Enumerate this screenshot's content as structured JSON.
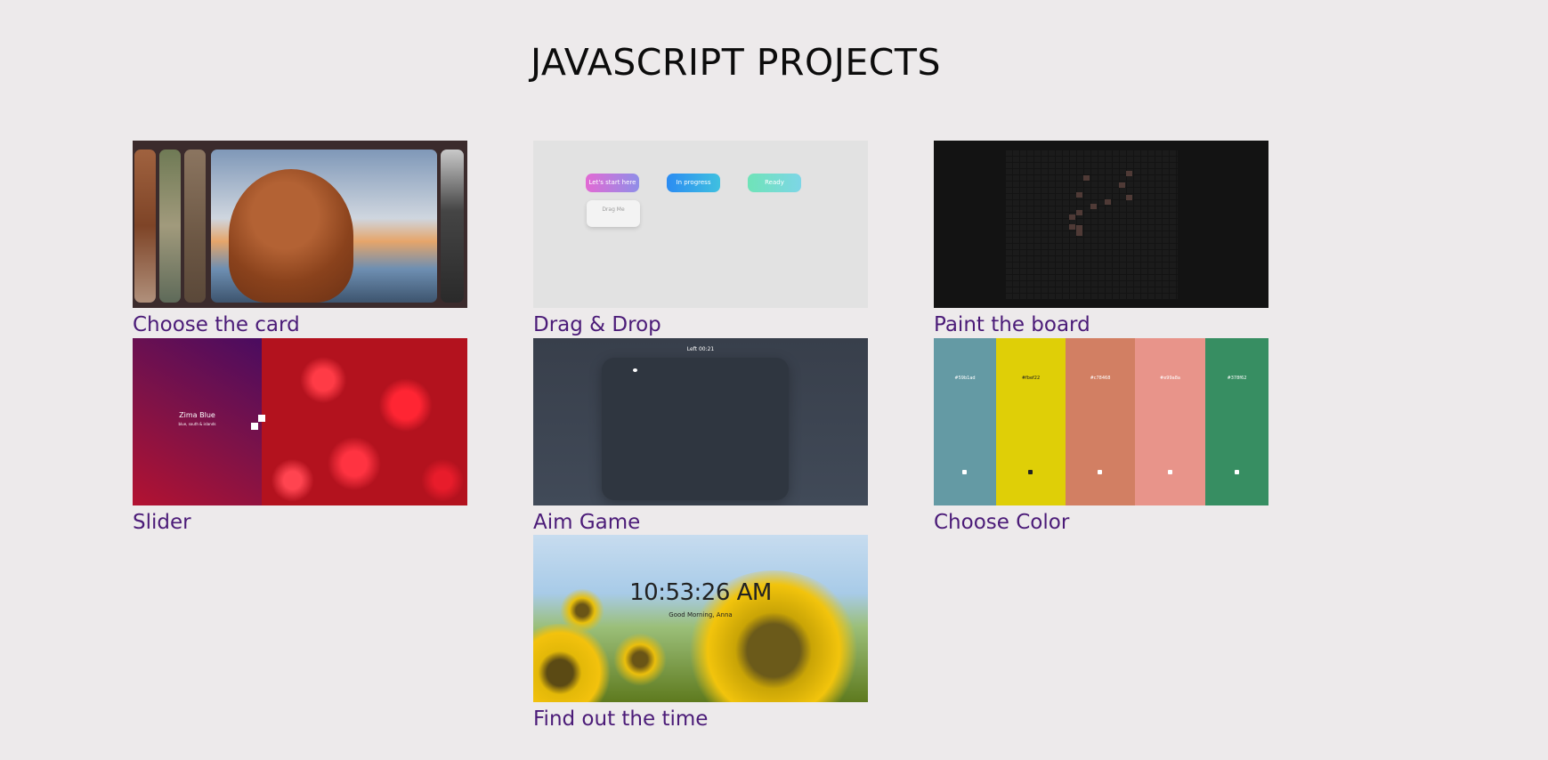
{
  "page_title": "JAVASCRIPT PROJECTS",
  "projects": [
    {
      "label": "Choose the card"
    },
    {
      "label": "Drag & Drop",
      "columns": [
        "Let's start here",
        "In progress",
        "Ready"
      ],
      "draggable": "Drag Me"
    },
    {
      "label": "Paint the board"
    },
    {
      "label": "Slider",
      "slide_title": "Zima Blue",
      "slide_sub": "blue, south & islands"
    },
    {
      "label": "Aim Game",
      "score_text": "Left 00:21"
    },
    {
      "label": "Choose Color",
      "swatches": [
        {
          "hex": "#59b1ad",
          "color": "#649aa4"
        },
        {
          "hex": "#fbef22",
          "color": "#dfcf07"
        },
        {
          "hex": "#c78468",
          "color": "#d27f63"
        },
        {
          "hex": "#e99a8a",
          "color": "#e8948a"
        },
        {
          "hex": "#378f62",
          "color": "#378e62"
        }
      ]
    },
    {
      "label": "Find out the time",
      "time": "10:53:26 AM",
      "greeting": "Good Morning, Anna"
    }
  ],
  "colors": {
    "background": "#edeaeb",
    "label": "#4b1b78",
    "title": "#0c0c0c"
  }
}
